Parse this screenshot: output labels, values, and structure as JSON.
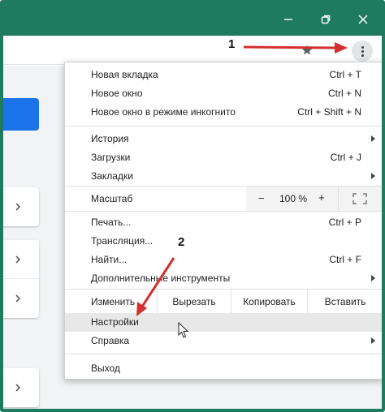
{
  "window": {
    "minimize_icon": "minimize-icon",
    "restore_icon": "restore-icon",
    "close_icon": "close-icon",
    "frame_color": "#1e7b5e"
  },
  "toolbar": {
    "bookmark_icon": "star-icon",
    "menu_icon": "kebab-menu-icon"
  },
  "menu": {
    "items": [
      {
        "label": "Новая вкладка",
        "shortcut": "Ctrl + T"
      },
      {
        "label": "Новое окно",
        "shortcut": "Ctrl + N"
      },
      {
        "label": "Новое окно в режиме инкогнито",
        "shortcut": "Ctrl + Shift + N"
      },
      {
        "label": "История",
        "shortcut": ""
      },
      {
        "label": "Загрузки",
        "shortcut": "Ctrl + J"
      },
      {
        "label": "Закладки",
        "shortcut": ""
      },
      {
        "label": "Печать...",
        "shortcut": "Ctrl + P"
      },
      {
        "label": "Трансляция...",
        "shortcut": ""
      },
      {
        "label": "Найти...",
        "shortcut": "Ctrl + F"
      },
      {
        "label": "Дополнительные инструменты",
        "shortcut": ""
      },
      {
        "label": "Настройки",
        "shortcut": ""
      },
      {
        "label": "Справка",
        "shortcut": ""
      },
      {
        "label": "Выход",
        "shortcut": ""
      }
    ],
    "zoom": {
      "label": "Масштаб",
      "minus": "−",
      "value": "100 %",
      "plus": "+"
    },
    "edit": {
      "label": "Изменить",
      "cut": "Вырезать",
      "copy": "Копировать",
      "paste": "Вставить"
    }
  },
  "annotations": {
    "step1": "1",
    "step2": "2",
    "arrow_color": "#d32f2f"
  }
}
